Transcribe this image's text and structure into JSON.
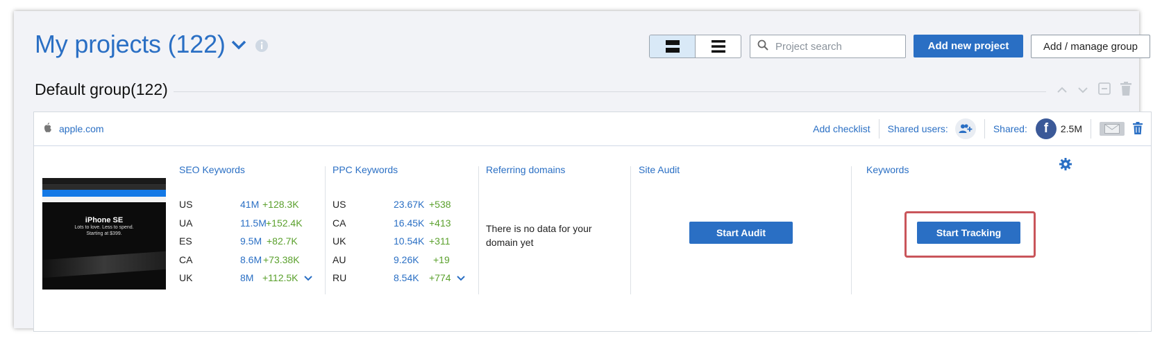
{
  "header": {
    "title": "My projects (122)",
    "search_placeholder": "Project search",
    "add_project_label": "Add new project",
    "add_group_label": "Add / manage group"
  },
  "group": {
    "title": "Default group(122)"
  },
  "project": {
    "domain": "apple.com",
    "add_checklist": "Add checklist",
    "shared_users_label": "Shared users:",
    "shared_label": "Shared:",
    "facebook_letter": "f",
    "shared_count": "2.5M",
    "thumbnail": {
      "heading": "iPhone SE",
      "sub1": "Lots to love. Less to spend.",
      "sub2": "Starting at $399."
    },
    "seo": {
      "title": "SEO Keywords",
      "rows": [
        {
          "country": "US",
          "value": "41M",
          "delta": "+128.3K"
        },
        {
          "country": "UA",
          "value": "11.5M",
          "delta": "+152.4K"
        },
        {
          "country": "ES",
          "value": "9.5M",
          "delta": "+82.7K"
        },
        {
          "country": "CA",
          "value": "8.6M",
          "delta": "+73.38K"
        },
        {
          "country": "UK",
          "value": "8M",
          "delta": "+112.5K"
        }
      ]
    },
    "ppc": {
      "title": "PPC Keywords",
      "rows": [
        {
          "country": "US",
          "value": "23.67K",
          "delta": "+538"
        },
        {
          "country": "CA",
          "value": "16.45K",
          "delta": "+413"
        },
        {
          "country": "UK",
          "value": "10.54K",
          "delta": "+311"
        },
        {
          "country": "AU",
          "value": "9.26K",
          "delta": "+19"
        },
        {
          "country": "RU",
          "value": "8.54K",
          "delta": "+774"
        }
      ]
    },
    "referring": {
      "title": "Referring domains",
      "no_data": "There is no data for your domain yet"
    },
    "audit": {
      "title": "Site Audit",
      "button": "Start Audit"
    },
    "keywords": {
      "title": "Keywords",
      "button": "Start Tracking"
    }
  },
  "colors": {
    "accent": "#2a6fc4",
    "positive": "#5aa02c",
    "highlight": "#c9555a"
  }
}
